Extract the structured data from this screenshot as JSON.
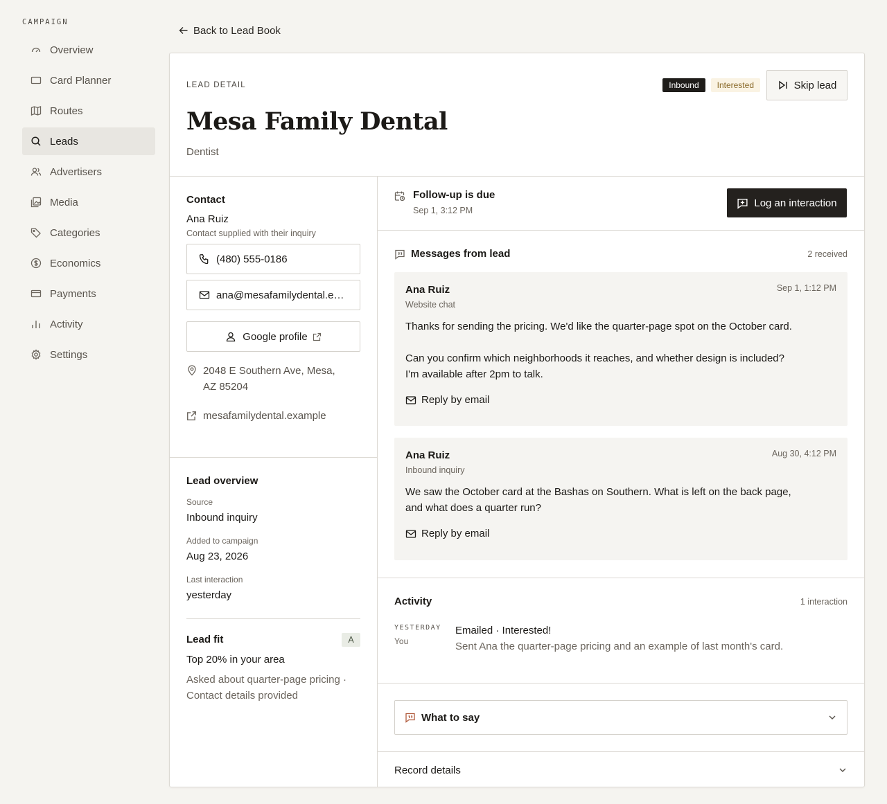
{
  "sidebar": {
    "heading": "CAMPAIGN",
    "items": [
      {
        "label": "Overview",
        "icon": "gauge-icon"
      },
      {
        "label": "Card Planner",
        "icon": "card-icon"
      },
      {
        "label": "Routes",
        "icon": "map-icon"
      },
      {
        "label": "Leads",
        "icon": "search-icon",
        "active": true
      },
      {
        "label": "Advertisers",
        "icon": "users-icon"
      },
      {
        "label": "Media",
        "icon": "images-icon"
      },
      {
        "label": "Categories",
        "icon": "tag-icon"
      },
      {
        "label": "Economics",
        "icon": "dollar-icon"
      },
      {
        "label": "Payments",
        "icon": "credit-card-icon"
      },
      {
        "label": "Activity",
        "icon": "bar-chart-icon"
      },
      {
        "label": "Settings",
        "icon": "gear-icon"
      }
    ]
  },
  "back_link": "Back to Lead Book",
  "header": {
    "eyebrow": "LEAD DETAIL",
    "name": "Mesa Family Dental",
    "category": "Dentist",
    "badges": {
      "inbound": "Inbound",
      "interested": "Interested"
    },
    "skip_label": "Skip lead"
  },
  "contact": {
    "title": "Contact",
    "name": "Ana Ruiz",
    "note": "Contact supplied with their inquiry",
    "phone": "(480) 555-0186",
    "email": "ana@mesafamilydental.exa...",
    "profile_label": "Google profile",
    "address": "2048 E Southern Ave, Mesa, AZ 85204",
    "website": "mesafamilydental.example"
  },
  "overview": {
    "title": "Lead overview",
    "source_label": "Source",
    "source_value": "Inbound inquiry",
    "added_label": "Added to campaign",
    "added_value": "Aug 23, 2026",
    "last_label": "Last interaction",
    "last_value": "yesterday"
  },
  "fit": {
    "title": "Lead fit",
    "grade": "A",
    "value": "Top 20% in your area",
    "description": "Asked about quarter-page pricing · Contact details provided"
  },
  "followup": {
    "title": "Follow-up is due",
    "time": "Sep 1, 3:12 PM",
    "log_label": "Log an interaction"
  },
  "messages": {
    "title": "Messages from lead",
    "count": "2 received",
    "reply_label": "Reply by email",
    "items": [
      {
        "author": "Ana Ruiz",
        "channel": "Website chat",
        "time": "Sep 1, 1:12 PM",
        "body1": "Thanks for sending the pricing. We'd like the quarter-page spot on the October card.",
        "body2": "Can you confirm which neighborhoods it reaches, and whether design is included? I'm available after 2pm to talk."
      },
      {
        "author": "Ana Ruiz",
        "channel": "Inbound inquiry",
        "time": "Aug 30, 4:12 PM",
        "body1": "We saw the October card at the Bashas on Southern. What is left on the back page, and what does a quarter run?"
      }
    ]
  },
  "activity": {
    "title": "Activity",
    "count": "1 interaction",
    "day": "YESTERDAY",
    "who": "You",
    "entry_title": "Emailed · Interested!",
    "entry_desc": "Sent Ana the quarter-page pricing and an example of last month's card."
  },
  "what_to_say": "What to say",
  "record_details": "Record details"
}
